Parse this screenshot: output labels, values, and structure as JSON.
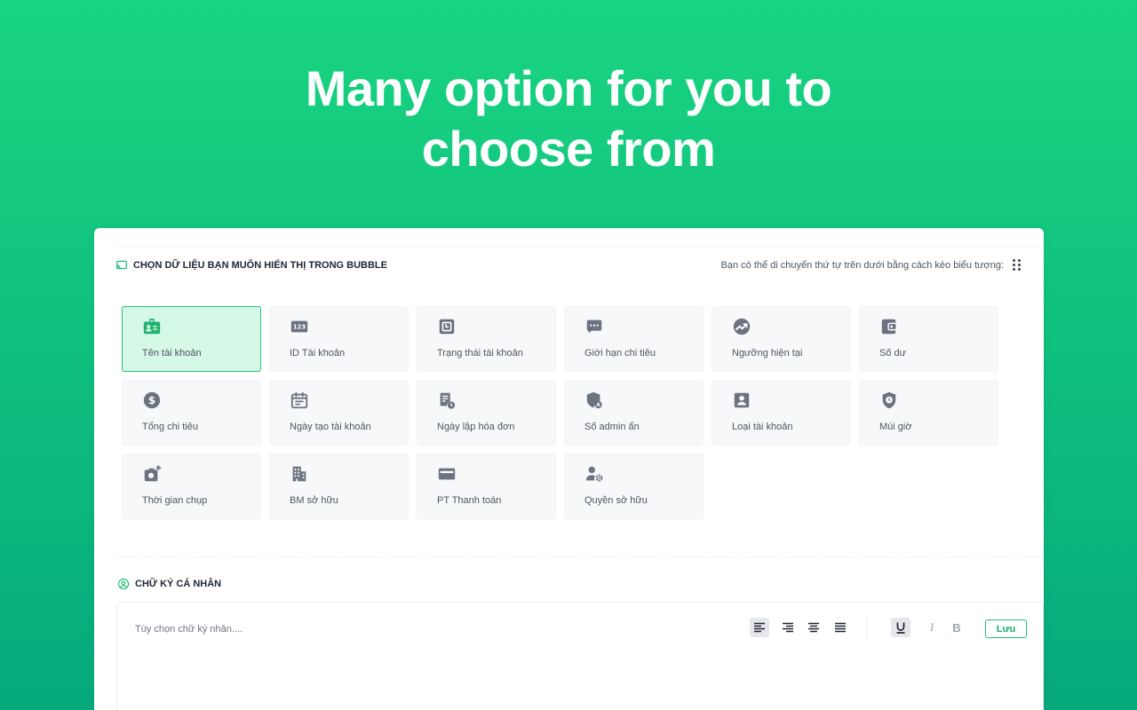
{
  "hero": {
    "line1": "Many option for you to",
    "line2": "choose from"
  },
  "section1": {
    "title": "CHỌN DỮ LIỆU BẠN MUỐN HIỂN THỊ TRONG BUBBLE",
    "hint": "Bạn có thể di chuyển thứ tự trên dưới bằng cách kéo biểu tượng:",
    "cards": [
      {
        "label": "Tên tài khoản",
        "icon": "id-badge-icon",
        "selected": true
      },
      {
        "label": "ID Tài khoản",
        "icon": "number-123-icon",
        "selected": false
      },
      {
        "label": "Trạng thái tài khoản",
        "icon": "status-square-icon",
        "selected": false
      },
      {
        "label": "Giới hạn chi tiêu",
        "icon": "chat-dots-icon",
        "selected": false
      },
      {
        "label": "Ngưỡng hiện tại",
        "icon": "trending-chart-icon",
        "selected": false
      },
      {
        "label": "Số dư",
        "icon": "wallet-icon",
        "selected": false
      },
      {
        "label": "Tổng chi tiêu",
        "icon": "dollar-circle-icon",
        "selected": false
      },
      {
        "label": "Ngày tạo tài khoản",
        "icon": "calendar-icon",
        "selected": false
      },
      {
        "label": "Ngày  lập hóa đơn",
        "icon": "invoice-clock-icon",
        "selected": false
      },
      {
        "label": "Số admin ẩn",
        "icon": "shield-user-icon",
        "selected": false
      },
      {
        "label": "Loại tài khoản",
        "icon": "account-box-icon",
        "selected": false
      },
      {
        "label": "Múi giờ",
        "icon": "shield-clock-icon",
        "selected": false
      },
      {
        "label": "Thời gian chụp",
        "icon": "camera-plus-icon",
        "selected": false
      },
      {
        "label": "BM sở hữu",
        "icon": "building-icon",
        "selected": false
      },
      {
        "label": "PT Thanh toán",
        "icon": "credit-card-icon",
        "selected": false
      },
      {
        "label": "Quyền sở hữu",
        "icon": "user-gear-icon",
        "selected": false
      }
    ]
  },
  "section2": {
    "title": "CHỮ KÝ CÁ NHÂN",
    "placeholder": "Tùy chọn chữ ký nhân....",
    "save_label": "Lưu",
    "italic_label": "I",
    "bold_label": "B"
  },
  "colors": {
    "accent": "#1fbf78",
    "selected_bg": "#d6f8e6",
    "icon_gray": "#6b7280"
  }
}
